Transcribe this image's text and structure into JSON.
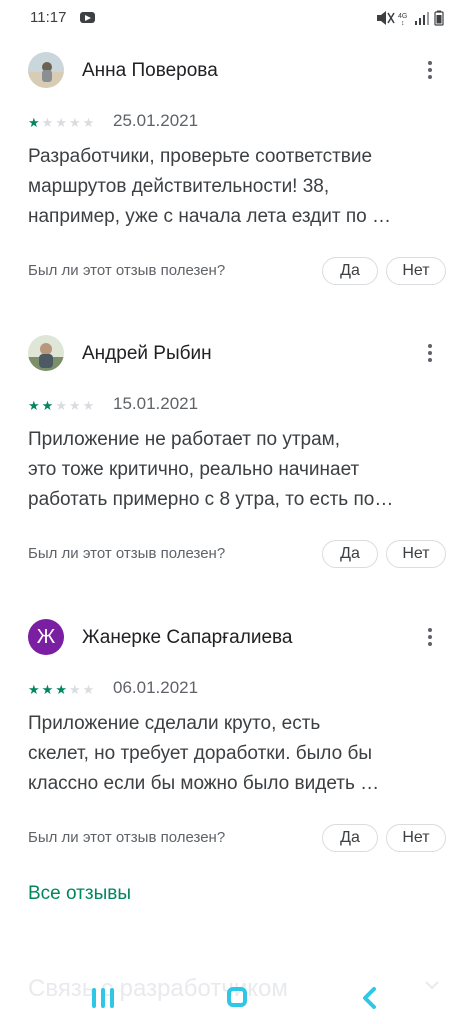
{
  "status_bar": {
    "time": "11:17",
    "icons": [
      "youtube-icon",
      "mute-icon",
      "4g-icon",
      "signal-icon",
      "battery-icon"
    ]
  },
  "reviews": [
    {
      "name": "Анна Поверова",
      "rating": 1,
      "max_rating": 5,
      "date": "25.01.2021",
      "text_lines": [
        "Разработчики, проверьте соответствие",
        "маршрутов действительности! 38,",
        "например, уже с начала лета ездит по …"
      ],
      "helpful_question": "Был ли этот отзыв полезен?",
      "yes_label": "Да",
      "no_label": "Нет"
    },
    {
      "name": "Андрей Рыбин",
      "rating": 2,
      "max_rating": 5,
      "date": "15.01.2021",
      "text_lines": [
        "Приложение не работает по утрам,",
        "это тоже критично, реально начинает",
        "работать примерно с 8 утра, то есть по…"
      ],
      "helpful_question": "Был ли этот отзыв полезен?",
      "yes_label": "Да",
      "no_label": "Нет"
    },
    {
      "name": "Жанерке Сапарғалиева",
      "avatar_letter": "Ж",
      "rating": 3,
      "max_rating": 5,
      "date": "06.01.2021",
      "text_lines": [
        "Приложение сделали круто, есть",
        "скелет, но требует доработки. было бы",
        "классно если бы можно было видеть …"
      ],
      "helpful_question": "Был ли этот отзыв полезен?",
      "yes_label": "Да",
      "no_label": "Нет"
    }
  ],
  "all_reviews_link": "Все отзывы",
  "developer_contact": "Связь с разработчиком",
  "colors": {
    "accent_green": "#01875f",
    "star_off": "#dadce0",
    "nav_cyan": "#2ec8e6",
    "avatar_purple": "#7b1fa2"
  }
}
